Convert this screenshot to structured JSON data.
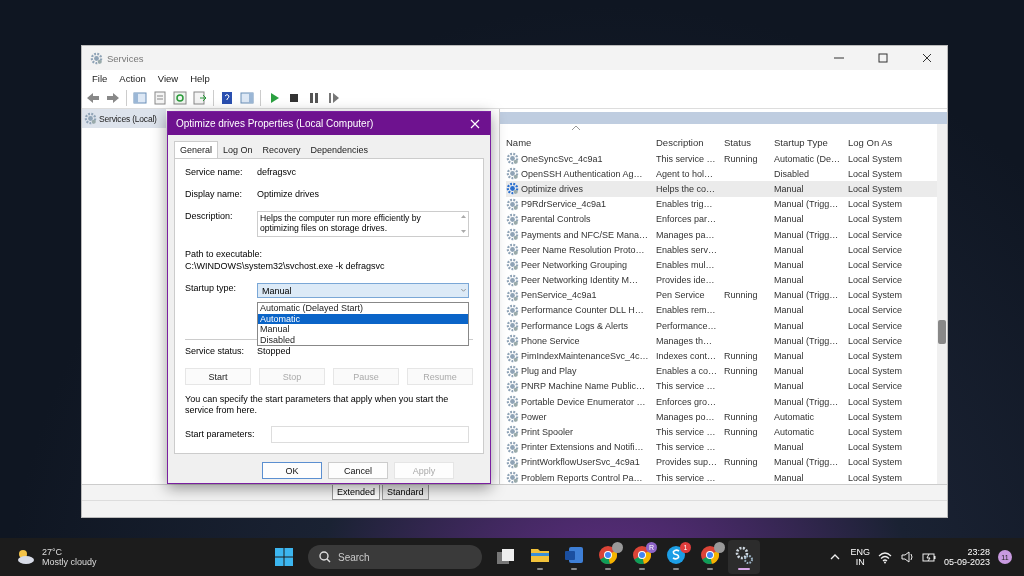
{
  "window": {
    "title": "Services",
    "menu": [
      "File",
      "Action",
      "View",
      "Help"
    ],
    "tree_item": "Services (Local)"
  },
  "table": {
    "columns": [
      "Name",
      "Description",
      "Status",
      "Startup Type",
      "Log On As"
    ],
    "rows": [
      {
        "name": "OneSyncSvc_4c9a1",
        "description": "This service …",
        "status": "Running",
        "startup_type": "Automatic (De…",
        "log_on_as": "Local System",
        "selected": false
      },
      {
        "name": "OpenSSH Authentication Ag…",
        "description": "Agent to hol…",
        "startup_type": "Disabled",
        "log_on_as": "Local System",
        "selected": false
      },
      {
        "name": "Optimize drives",
        "description": "Helps the co…",
        "startup_type": "Manual",
        "log_on_as": "Local System",
        "selected": true
      },
      {
        "name": "P9RdrService_4c9a1",
        "description": "Enables trig…",
        "startup_type": "Manual (Trigg…",
        "log_on_as": "Local System",
        "selected": false
      },
      {
        "name": "Parental Controls",
        "description": "Enforces par…",
        "startup_type": "Manual",
        "log_on_as": "Local System",
        "selected": false
      },
      {
        "name": "Payments and NFC/SE Mana…",
        "description": "Manages pa…",
        "startup_type": "Manual (Trigg…",
        "log_on_as": "Local Service",
        "selected": false
      },
      {
        "name": "Peer Name Resolution Proto…",
        "description": "Enables serv…",
        "startup_type": "Manual",
        "log_on_as": "Local Service",
        "selected": false
      },
      {
        "name": "Peer Networking Grouping",
        "description": "Enables mul…",
        "startup_type": "Manual",
        "log_on_as": "Local Service",
        "selected": false
      },
      {
        "name": "Peer Networking Identity M…",
        "description": "Provides ide…",
        "startup_type": "Manual",
        "log_on_as": "Local Service",
        "selected": false
      },
      {
        "name": "PenService_4c9a1",
        "description": "Pen Service",
        "status": "Running",
        "startup_type": "Manual (Trigg…",
        "log_on_as": "Local System",
        "selected": false
      },
      {
        "name": "Performance Counter DLL H…",
        "description": "Enables rem…",
        "startup_type": "Manual",
        "log_on_as": "Local Service",
        "selected": false
      },
      {
        "name": "Performance Logs & Alerts",
        "description": "Performance…",
        "startup_type": "Manual",
        "log_on_as": "Local Service",
        "selected": false
      },
      {
        "name": "Phone Service",
        "description": "Manages th…",
        "startup_type": "Manual (Trigg…",
        "log_on_as": "Local Service",
        "selected": false
      },
      {
        "name": "PimIndexMaintenanceSvc_4c…",
        "description": "Indexes cont…",
        "status": "Running",
        "startup_type": "Manual",
        "log_on_as": "Local System",
        "selected": false
      },
      {
        "name": "Plug and Play",
        "description": "Enables a co…",
        "status": "Running",
        "startup_type": "Manual",
        "log_on_as": "Local System",
        "selected": false
      },
      {
        "name": "PNRP Machine Name Public…",
        "description": "This service …",
        "startup_type": "Manual",
        "log_on_as": "Local Service",
        "selected": false
      },
      {
        "name": "Portable Device Enumerator …",
        "description": "Enforces gro…",
        "startup_type": "Manual (Trigg…",
        "log_on_as": "Local System",
        "selected": false
      },
      {
        "name": "Power",
        "description": "Manages po…",
        "status": "Running",
        "startup_type": "Automatic",
        "log_on_as": "Local System",
        "selected": false
      },
      {
        "name": "Print Spooler",
        "description": "This service …",
        "status": "Running",
        "startup_type": "Automatic",
        "log_on_as": "Local System",
        "selected": false
      },
      {
        "name": "Printer Extensions and Notifi…",
        "description": "This service …",
        "startup_type": "Manual",
        "log_on_as": "Local System",
        "selected": false
      },
      {
        "name": "PrintWorkflowUserSvc_4c9a1",
        "description": "Provides sup…",
        "status": "Running",
        "startup_type": "Manual (Trigg…",
        "log_on_as": "Local System",
        "selected": false
      },
      {
        "name": "Problem Reports Control Pa…",
        "description": "This service …",
        "startup_type": "Manual",
        "log_on_as": "Local System",
        "selected": false
      }
    ]
  },
  "view_tabs": [
    {
      "label": "Extended",
      "selected": true
    },
    {
      "label": "Standard",
      "selected": false
    }
  ],
  "dialog": {
    "title": "Optimize drives Properties (Local Computer)",
    "tabs": [
      {
        "label": "General",
        "selected": true
      },
      {
        "label": "Log On",
        "selected": false
      },
      {
        "label": "Recovery",
        "selected": false
      },
      {
        "label": "Dependencies",
        "selected": false
      }
    ],
    "fields": [
      {
        "label": "Service name:",
        "value": "defragsvc"
      },
      {
        "label": "Display name:",
        "value": "Optimize drives"
      }
    ],
    "description_label": "Description:",
    "description": "Helps the computer run more efficiently by optimizing files on storage drives.",
    "path_label": "Path to executable:",
    "path": "C:\\WINDOWS\\system32\\svchost.exe -k defragsvc",
    "startup_label": "Startup type:",
    "startup_value": "Manual",
    "startup_options": [
      {
        "label": "Automatic (Delayed Start)",
        "selected": false
      },
      {
        "label": "Automatic",
        "selected": true
      },
      {
        "label": "Manual",
        "selected": false
      },
      {
        "label": "Disabled",
        "selected": false
      }
    ],
    "status_label": "Service status:",
    "status_value": "Stopped",
    "service_buttons": [
      {
        "label": "Start",
        "disabled": false
      },
      {
        "label": "Stop",
        "disabled": true
      },
      {
        "label": "Pause",
        "disabled": true
      },
      {
        "label": "Resume",
        "disabled": true
      }
    ],
    "hint": "You can specify the start parameters that apply when you start the service from here.",
    "params_label": "Start parameters:",
    "footer_buttons": [
      {
        "label": "OK",
        "disabled": false
      },
      {
        "label": "Cancel",
        "disabled": false
      },
      {
        "label": "Apply",
        "disabled": true
      }
    ]
  },
  "taskbar": {
    "temperature": "27°C",
    "weather": "Mostly cloudy",
    "search_placeholder": "Search",
    "apps": [
      {
        "kind": "taskview",
        "running": false,
        "active": false
      },
      {
        "kind": "folder",
        "running": true,
        "active": false
      },
      {
        "kind": "word",
        "running": true,
        "active": false
      },
      {
        "kind": "browser",
        "badge": {
          "kind": "avatar"
        },
        "running": true,
        "active": false
      },
      {
        "kind": "browser",
        "badge": {
          "kind": "letter",
          "text": "R"
        },
        "running": true,
        "active": false
      },
      {
        "kind": "skype",
        "badge": {
          "kind": "count",
          "text": "1"
        },
        "running": true,
        "active": false
      },
      {
        "kind": "browser",
        "badge": {
          "kind": "avatar"
        },
        "running": true,
        "active": false
      },
      {
        "kind": "gears",
        "running": true,
        "active": true
      }
    ],
    "language": "ENG",
    "region": "IN",
    "time": "23:28",
    "date": "05-09-2023",
    "notifications": "11"
  }
}
